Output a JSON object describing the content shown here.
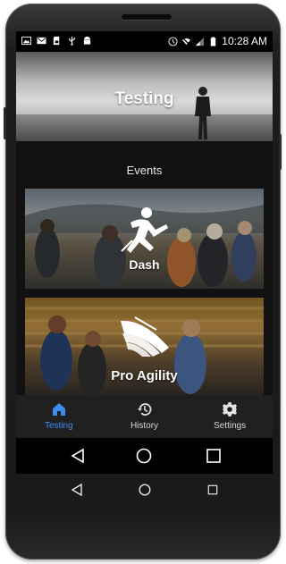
{
  "status_bar": {
    "time": "10:28 AM",
    "left_icons": [
      "gallery-icon",
      "mail-icon",
      "sd-card-icon",
      "usb-icon",
      "android-debug-icon"
    ],
    "right_icons": [
      "vibrate-icon",
      "no-wifi-icon",
      "signal-icon",
      "battery-icon"
    ]
  },
  "header": {
    "title": "Testing"
  },
  "section": {
    "title": "Events"
  },
  "events": [
    {
      "label": "Dash",
      "icon": "sprinter-icon"
    },
    {
      "label": "Pro Agility",
      "icon": "winged-icon"
    }
  ],
  "bottom_nav": {
    "active": "Testing",
    "items": [
      {
        "label": "Testing",
        "icon": "home-icon"
      },
      {
        "label": "History",
        "icon": "history-icon"
      },
      {
        "label": "Settings",
        "icon": "gear-icon"
      }
    ]
  },
  "system_nav": [
    "back-icon",
    "home-circle-icon",
    "recents-icon"
  ],
  "colors": {
    "accent": "#3f8cf0",
    "nav_bg": "#202020",
    "screen_bg": "#111111"
  }
}
